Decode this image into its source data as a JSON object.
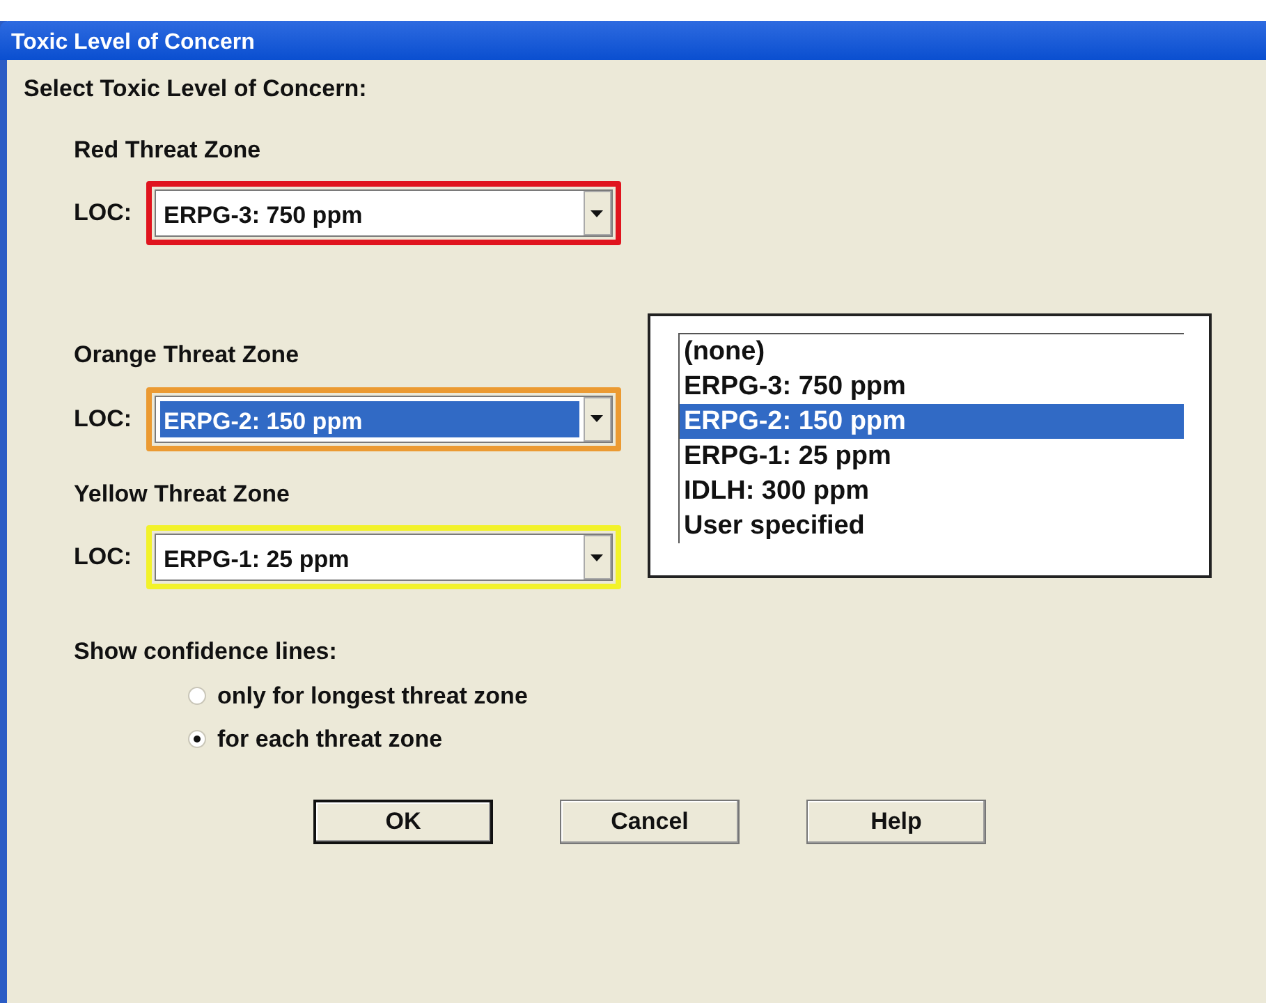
{
  "window": {
    "title": "Toxic Level of Concern"
  },
  "heading": "Select Toxic Level of Concern:",
  "zones": [
    {
      "label": "Red Threat Zone",
      "field_label": "LOC:",
      "value": "ERPG-3: 750 ppm",
      "color": "#e0141e",
      "focused": false
    },
    {
      "label": "Orange Threat Zone",
      "field_label": "LOC:",
      "value": "ERPG-2: 150 ppm",
      "color": "#eb9a32",
      "focused": true
    },
    {
      "label": "Yellow Threat Zone",
      "field_label": "LOC:",
      "value": "ERPG-1: 25 ppm",
      "color": "#f2f22a",
      "focused": false
    }
  ],
  "dropdown_list": {
    "options": [
      {
        "text": "(none)",
        "selected": false
      },
      {
        "text": "ERPG-3: 750 ppm",
        "selected": false
      },
      {
        "text": "ERPG-2: 150 ppm",
        "selected": true
      },
      {
        "text": "ERPG-1: 25 ppm",
        "selected": false
      },
      {
        "text": "IDLH: 300 ppm",
        "selected": false
      },
      {
        "text": "User specified",
        "selected": false
      }
    ]
  },
  "confidence": {
    "label": "Show confidence lines:",
    "options": [
      {
        "label": "only for longest threat zone",
        "selected": false
      },
      {
        "label": "for each threat zone",
        "selected": true
      }
    ]
  },
  "buttons": [
    {
      "label": "OK",
      "default": true
    },
    {
      "label": "Cancel",
      "default": false
    },
    {
      "label": "Help",
      "default": false
    }
  ]
}
